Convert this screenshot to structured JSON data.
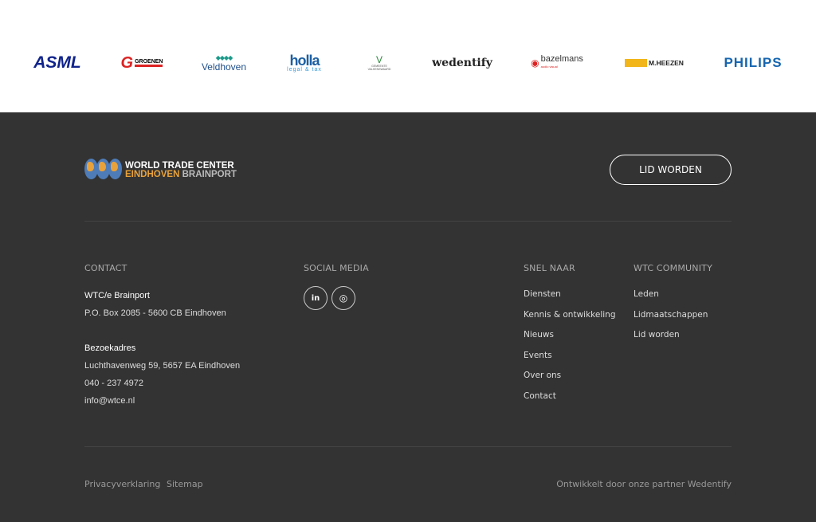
{
  "partners": [
    "ASML",
    "GROENEN",
    "Veldhoven",
    "holla",
    "legal & tax",
    "GEMEENTE VALKENSWAARD",
    "wedentify",
    "bazelmans",
    "audio visual",
    "M.HEEZEN",
    "PHILIPS"
  ],
  "footer": {
    "logo_line1": "WORLD TRADE CENTER",
    "logo_line2a": "EINDHOVEN",
    "logo_line2b": "BRAINPORT",
    "cta": "LID WORDEN",
    "contact": {
      "heading": "CONTACT",
      "name": "WTC/e Brainport",
      "pobox": "P.O. Box 2085 - 5600 CB Eindhoven",
      "visit_label": "Bezoekadres",
      "address": "Luchthavenweg 59, 5657 EA Eindhoven",
      "phone": "040 - 237 4972",
      "email": "info@wtce.nl"
    },
    "social": {
      "heading": "SOCIAL MEDIA",
      "linkedin": "in",
      "instagram": "◎"
    },
    "snel": {
      "heading": "SNEL NAAR",
      "items": [
        "Diensten",
        "Kennis & ontwikkeling",
        "Nieuws",
        "Events",
        "Over ons",
        "Contact"
      ]
    },
    "community": {
      "heading": "WTC COMMUNITY",
      "items": [
        "Leden",
        "Lidmaatschappen",
        "Lid worden"
      ]
    },
    "privacy": "Privacyverklaring",
    "sitemap": "Sitemap",
    "credit": "Ontwikkelt door onze partner Wedentify"
  }
}
